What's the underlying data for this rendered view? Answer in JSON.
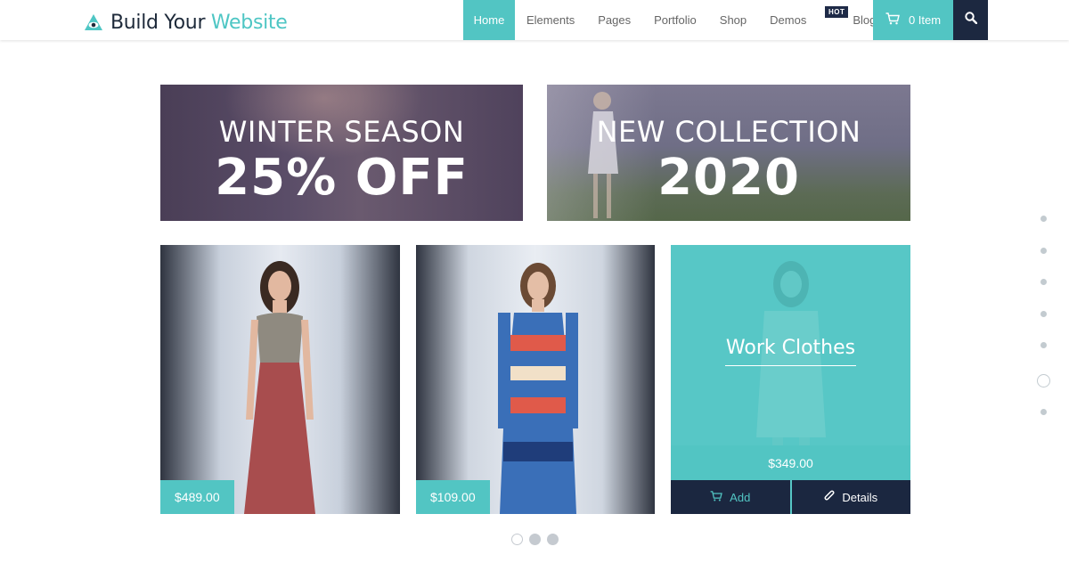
{
  "header": {
    "logo": {
      "text_main": "Build Your ",
      "text_accent": "Website",
      "icon": "eye-triangle-logo-icon"
    },
    "nav": [
      {
        "label": "Home",
        "active": true
      },
      {
        "label": "Elements",
        "active": false
      },
      {
        "label": "Pages",
        "active": false
      },
      {
        "label": "Portfolio",
        "active": false
      },
      {
        "label": "Shop",
        "active": false
      },
      {
        "label": "Demos",
        "active": false,
        "badge": "HOT"
      },
      {
        "label": "Blog",
        "active": false
      }
    ],
    "cart": {
      "label": "0 Item",
      "icon": "cart-icon"
    },
    "search": {
      "icon": "search-icon"
    }
  },
  "banners": [
    {
      "line1": "WINTER SEASON",
      "line2": "25% OFF"
    },
    {
      "line1": "NEW COLLECTION",
      "line2": "2020"
    }
  ],
  "products": [
    {
      "price": "$489.00",
      "dress_color": "#a84d4e"
    },
    {
      "price": "$109.00",
      "dress_color": "#3a6fb8"
    },
    {
      "title": "Work Clothes",
      "price": "$349.00",
      "add_label": "Add",
      "details_label": "Details",
      "add_icon": "cart-icon",
      "details_icon": "paperclip-icon"
    }
  ],
  "pager": {
    "count": 3,
    "active_index": 0
  },
  "side_nav": {
    "count": 7,
    "active_index": 5
  },
  "colors": {
    "accent": "#52c5c3",
    "dark": "#1b2740"
  }
}
